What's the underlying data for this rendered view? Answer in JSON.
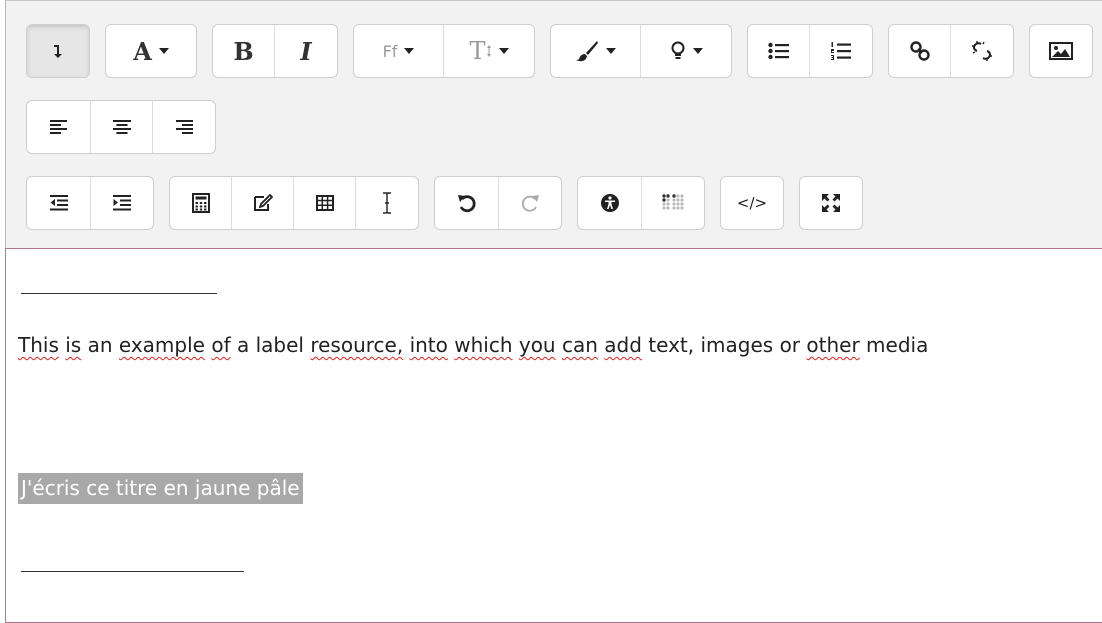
{
  "toolbar": {
    "row1": [
      {
        "name": "show-more-buttons",
        "icon": "arrow-down-icon"
      },
      {
        "name": "font-color",
        "icon": "text-color-icon",
        "label": "A"
      },
      {
        "name": "bold",
        "icon": "bold-icon",
        "label": "B"
      },
      {
        "name": "italic",
        "icon": "italic-icon",
        "label": "I"
      },
      {
        "name": "font-family",
        "icon": "font-family-icon",
        "label": "Ff"
      },
      {
        "name": "font-size",
        "icon": "font-size-icon",
        "label": "T"
      },
      {
        "name": "background-color",
        "icon": "paintbrush-icon"
      },
      {
        "name": "highlight",
        "icon": "lightbulb-icon"
      },
      {
        "name": "unordered-list",
        "icon": "bullet-list-icon"
      },
      {
        "name": "ordered-list",
        "icon": "numbered-list-icon"
      },
      {
        "name": "link",
        "icon": "link-icon"
      },
      {
        "name": "unlink",
        "icon": "unlink-icon"
      },
      {
        "name": "image",
        "icon": "image-icon"
      }
    ],
    "row2": [
      {
        "name": "align-left",
        "icon": "align-left-icon"
      },
      {
        "name": "align-center",
        "icon": "align-center-icon"
      },
      {
        "name": "align-right",
        "icon": "align-right-icon"
      }
    ],
    "row3": [
      {
        "name": "outdent",
        "icon": "outdent-icon"
      },
      {
        "name": "indent",
        "icon": "indent-icon"
      },
      {
        "name": "equation",
        "icon": "calculator-icon"
      },
      {
        "name": "special-characters",
        "icon": "edit-icon"
      },
      {
        "name": "table",
        "icon": "table-icon"
      },
      {
        "name": "clear-formatting",
        "icon": "text-cursor-icon"
      },
      {
        "name": "undo",
        "icon": "undo-icon"
      },
      {
        "name": "redo",
        "icon": "redo-icon",
        "disabled": true
      },
      {
        "name": "accessibility-checker",
        "icon": "accessibility-icon"
      },
      {
        "name": "screenreader-helper",
        "icon": "braille-icon"
      },
      {
        "name": "html",
        "icon": "code-icon",
        "label": "</>"
      },
      {
        "name": "fullscreen",
        "icon": "expand-icon"
      }
    ]
  },
  "content": {
    "words": [
      "This",
      "is",
      "an",
      "example",
      "of",
      "a",
      "label",
      "resource,",
      "into",
      "which",
      "you",
      "can",
      "add",
      "text,",
      "images",
      "or",
      "other",
      "media"
    ],
    "misspelled_indices": [
      0,
      1,
      3,
      4,
      7,
      8,
      9,
      10,
      11,
      12,
      16
    ],
    "highlighted_text": "J'écris ce titre en jaune pâle",
    "highlight_color": "#a8a8a8",
    "spellcheck_color": "#e02020"
  }
}
